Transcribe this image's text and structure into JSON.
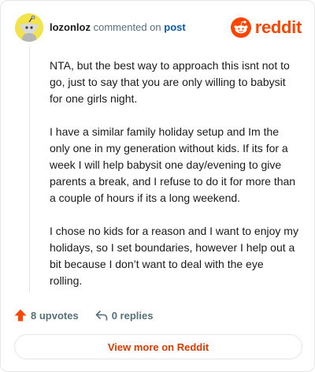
{
  "header": {
    "username": "lozonloz",
    "action_text": "commented on",
    "post_link": "post",
    "brand_name": "reddit"
  },
  "comment": {
    "paragraphs": [
      "NTA, but the best way to approach this isnt not to go, just to say that you are only willing to babysit for one girls night.",
      "I have a similar family holiday setup and Im the only one in my generation without kids. If its for a week I will help babysit one day/evening to give parents a break, and I refuse to do it for more than a couple of hours if its a long weekend.",
      "I chose no kids for a reason and I want to enjoy my holidays, so I set boundaries, however I help out a bit because I don’t want to deal with the eye rolling."
    ]
  },
  "footer": {
    "upvotes_label": "8 upvotes",
    "replies_label": "0 replies",
    "view_more_label": "View more on Reddit"
  },
  "colors": {
    "brand": "#ff4500",
    "link": "#0a5aa8",
    "view_more_text": "#d93a00",
    "avatar_bg": "#f2e34c"
  },
  "icons": {
    "upvote": "upvote-arrow-icon",
    "reply": "reply-arrow-icon",
    "brand": "reddit-snoo-icon",
    "avatar": "snoo-avatar-icon"
  }
}
